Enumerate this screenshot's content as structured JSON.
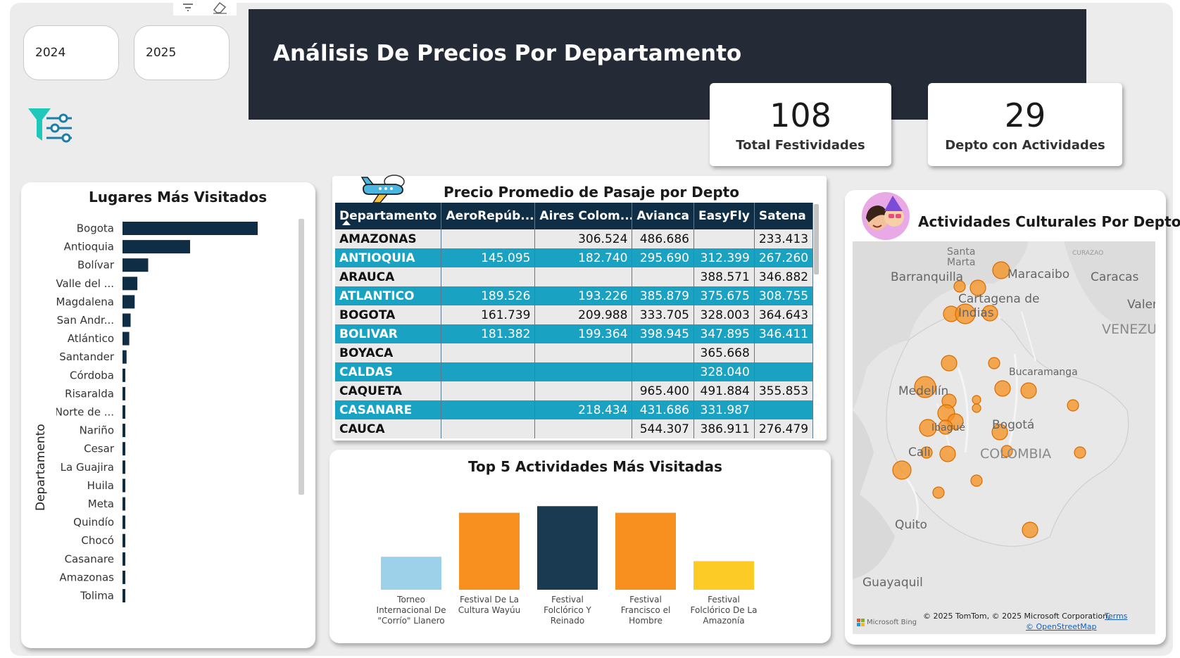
{
  "slicers": {
    "year_a": "2024",
    "year_b": "2025"
  },
  "header": {
    "title": "Análisis De Precios Por Departamento"
  },
  "kpis": {
    "total_festividades": {
      "value": "108",
      "label": "Total Festividades"
    },
    "depto_actividades": {
      "value": "29",
      "label": "Depto con Actividades"
    }
  },
  "visited": {
    "title": "Lugares Más Visitados",
    "axis_label": "Departamento"
  },
  "price_table": {
    "title": "Precio Promedio de Pasaje por Depto",
    "columns": [
      "Departamento",
      "AeroRepúb...",
      "Aires Colom...",
      "Avianca",
      "EasyFly",
      "Satena"
    ],
    "rows": [
      [
        "AMAZONAS",
        "",
        "306.524",
        "486.686",
        "",
        "233.413"
      ],
      [
        "ANTIOQUIA",
        "145.095",
        "182.740",
        "295.690",
        "312.399",
        "267.260"
      ],
      [
        "ARAUCA",
        "",
        "",
        "",
        "388.571",
        "346.882"
      ],
      [
        "ATLANTICO",
        "189.526",
        "193.226",
        "385.879",
        "375.675",
        "308.755"
      ],
      [
        "BOGOTA",
        "161.739",
        "209.988",
        "333.705",
        "328.003",
        "364.643"
      ],
      [
        "BOLIVAR",
        "181.382",
        "199.364",
        "398.945",
        "347.895",
        "346.411"
      ],
      [
        "BOYACA",
        "",
        "",
        "",
        "365.668",
        ""
      ],
      [
        "CALDAS",
        "",
        "",
        "",
        "328.040",
        ""
      ],
      [
        "CAQUETA",
        "",
        "",
        "965.400",
        "491.884",
        "355.853"
      ],
      [
        "CASANARE",
        "",
        "218.434",
        "431.686",
        "331.987",
        ""
      ],
      [
        "CAUCA",
        "",
        "",
        "544.307",
        "386.911",
        "276.479"
      ]
    ]
  },
  "top5": {
    "title": "Top 5 Actividades Más Visitadas"
  },
  "map": {
    "title": "Actividades Culturales Por Depto",
    "labels": {
      "santa_marta": "Santa\nMarta",
      "curazao": "CURAZAO",
      "barranquilla": "Barranquilla",
      "maracaibo": "Maracaibo",
      "caracas": "Caracas",
      "cartagena": "Cartagena de\nIndias",
      "valencia": "Valenc",
      "venezuela": "VENEZU",
      "bucaramanga": "Bucaramanga",
      "medellin": "Medellín",
      "ibague": "Ibagué",
      "bogota": "Bogotá",
      "cali": "Cali",
      "colombia": "COLOMBIA",
      "quito": "Quito",
      "guayaquil": "Guayaquil"
    },
    "attribution": "© 2025 TomTom, © 2025 Microsoft Corporation,",
    "terms": "Terms",
    "osm": "© OpenStreetMap",
    "bing": "Microsoft Bing"
  },
  "colors": {
    "navy": "#0f2d44",
    "header_bg": "#252a37",
    "teal": "#1aa2c3",
    "orange": "#f7901e",
    "light_blue": "#9dd1ea",
    "yellow": "#fdcb25",
    "filter_icon": "#1fc8b8"
  },
  "icons": [
    "filter-icon",
    "eraser-icon",
    "filter-sliders-icon",
    "airplane-icon",
    "festival-avatar-icon"
  ],
  "chart_data": [
    {
      "type": "bar",
      "orientation": "horizontal",
      "title": "Lugares Más Visitados",
      "ylabel": "Departamento",
      "categories": [
        "Bogota",
        "Antioquia",
        "Bolívar",
        "Valle del ...",
        "Magdalena",
        "San Andr...",
        "Atlántico",
        "Santander",
        "Córdoba",
        "Risaralda",
        "Norte de ...",
        "Nariño",
        "Cesar",
        "La Guajira",
        "Huila",
        "Meta",
        "Quindío",
        "Chocó",
        "Casanare",
        "Amazonas",
        "Tolima"
      ],
      "values": [
        100,
        50,
        19,
        11,
        9,
        6,
        5,
        3,
        2,
        1.5,
        1.2,
        1,
        0.7,
        0.6,
        0.5,
        0.45,
        0.4,
        0.35,
        0.3,
        0.25,
        0.2
      ],
      "color": "#0f2d44",
      "grid": false
    },
    {
      "type": "bar",
      "title": "Top 5 Actividades Más Visitadas",
      "categories": [
        "Torneo\nInternacional De\n\"Corrío\" Llanero",
        "Festival De La\nCultura Wayúu",
        "Festival\nFolclórico Y\nReinado",
        "Festival\nFrancisco el\nHombre",
        "Festival\nFolclórico De La\nAmazonía"
      ],
      "values": [
        30,
        70,
        76,
        70,
        26
      ],
      "bar_colors": [
        "#9dd1ea",
        "#f7901e",
        "#1a3a52",
        "#f7901e",
        "#fdcb25"
      ],
      "ylim": [
        0,
        80
      ],
      "grid": false
    }
  ]
}
